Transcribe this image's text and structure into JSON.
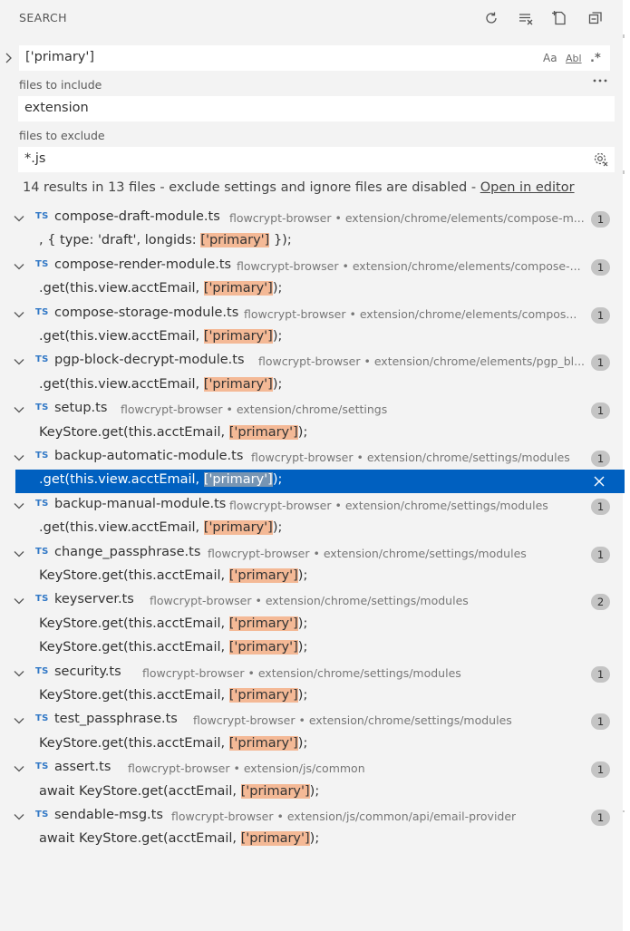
{
  "header": {
    "title": "SEARCH",
    "actions": [
      "refresh-icon",
      "clear-results-icon",
      "new-search-editor-icon",
      "collapse-all-icon"
    ]
  },
  "search": {
    "value": "['primary']",
    "match_case": "Aa",
    "whole_word": "Abl",
    "regex": ".*"
  },
  "include": {
    "label": "files to include",
    "value": "extension"
  },
  "exclude": {
    "label": "files to exclude",
    "value": "*.js"
  },
  "summary": {
    "text": "14 results in 13 files - exclude settings and ignore files are disabled - ",
    "link": "Open in editor"
  },
  "colors": {
    "selection": "#0060c0",
    "highlight": "#f4b996",
    "ts_icon": "#3178c6"
  },
  "results": [
    {
      "file": "compose-draft-module.ts",
      "path": "flowcrypt-browser • extension/chrome/elements/compose-m...",
      "count": "1",
      "matches": [
        {
          "before": ", { type: 'draft', longids: ",
          "hit": "['primary']",
          "after": " });",
          "indent": 43
        }
      ]
    },
    {
      "file": "compose-render-module.ts",
      "path": "flowcrypt-browser • extension/chrome/elements/compose-...",
      "count": "1",
      "matches": [
        {
          "before": ".get(this.view.acctEmail, ",
          "hit": "['primary']",
          "after": ");",
          "indent": 43
        }
      ]
    },
    {
      "file": "compose-storage-module.ts",
      "path": "flowcrypt-browser • extension/chrome/elements/compos...",
      "count": "1",
      "matches": [
        {
          "before": ".get(this.view.acctEmail, ",
          "hit": "['primary']",
          "after": ");",
          "indent": 43
        }
      ]
    },
    {
      "file": "pgp-block-decrypt-module.ts",
      "path": "flowcrypt-browser • extension/chrome/elements/pgp_bl...",
      "count": "1",
      "matches": [
        {
          "before": ".get(this.view.acctEmail, ",
          "hit": "['primary']",
          "after": ");",
          "indent": 43
        }
      ]
    },
    {
      "file": "setup.ts",
      "path": "flowcrypt-browser • extension/chrome/settings",
      "count": "1",
      "matches": [
        {
          "before": "KeyStore.get(this.acctEmail, ",
          "hit": "['primary']",
          "after": ");",
          "indent": 43
        }
      ]
    },
    {
      "file": "backup-automatic-module.ts",
      "path": "flowcrypt-browser • extension/chrome/settings/modules",
      "count": "1",
      "matches": [
        {
          "before": ".get(this.view.acctEmail, ",
          "hit": "['primary']",
          "after": ");",
          "indent": 43,
          "selected": true
        }
      ]
    },
    {
      "file": "backup-manual-module.ts",
      "path": "flowcrypt-browser • extension/chrome/settings/modules",
      "count": "1",
      "matches": [
        {
          "before": ".get(this.view.acctEmail, ",
          "hit": "['primary']",
          "after": ");",
          "indent": 43
        }
      ]
    },
    {
      "file": "change_passphrase.ts",
      "path": "flowcrypt-browser • extension/chrome/settings/modules",
      "count": "1",
      "matches": [
        {
          "before": "KeyStore.get(this.acctEmail, ",
          "hit": "['primary']",
          "after": ");",
          "indent": 43
        }
      ]
    },
    {
      "file": "keyserver.ts",
      "path": "flowcrypt-browser • extension/chrome/settings/modules",
      "count": "2",
      "matches": [
        {
          "before": "KeyStore.get(this.acctEmail, ",
          "hit": "['primary']",
          "after": ");",
          "indent": 43
        },
        {
          "before": "KeyStore.get(this.acctEmail, ",
          "hit": "['primary']",
          "after": ");",
          "indent": 43
        }
      ]
    },
    {
      "file": "security.ts",
      "path": "flowcrypt-browser • extension/chrome/settings/modules",
      "count": "1",
      "matches": [
        {
          "before": "KeyStore.get(this.acctEmail, ",
          "hit": "['primary']",
          "after": ");",
          "indent": 43
        }
      ]
    },
    {
      "file": "test_passphrase.ts",
      "path": "flowcrypt-browser • extension/chrome/settings/modules",
      "count": "1",
      "matches": [
        {
          "before": "KeyStore.get(this.acctEmail, ",
          "hit": "['primary']",
          "after": ");",
          "indent": 43
        }
      ]
    },
    {
      "file": "assert.ts",
      "path": "flowcrypt-browser • extension/js/common",
      "count": "1",
      "matches": [
        {
          "before": "await KeyStore.get(acctEmail, ",
          "hit": "['primary']",
          "after": ");",
          "indent": 43
        }
      ]
    },
    {
      "file": "sendable-msg.ts",
      "path": "flowcrypt-browser • extension/js/common/api/email-provider",
      "count": "1",
      "matches": [
        {
          "before": "await KeyStore.get(acctEmail, ",
          "hit": "['primary']",
          "after": ");",
          "indent": 43
        }
      ]
    }
  ]
}
